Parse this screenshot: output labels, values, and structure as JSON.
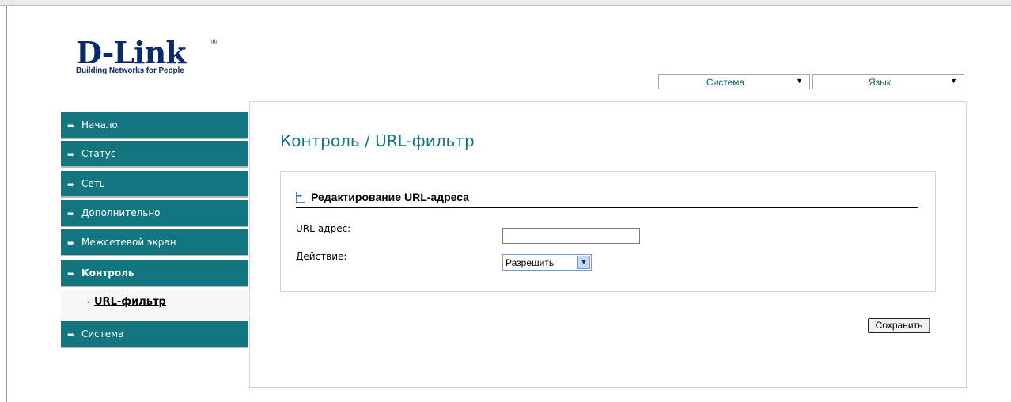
{
  "logo": {
    "name": "D-Link",
    "registered": "®",
    "tagline": "Building Networks for People"
  },
  "top_selectors": {
    "system": {
      "value": "Система",
      "icon": "triangle-down-icon"
    },
    "language": {
      "value": "Язык",
      "icon": "triangle-down-icon"
    }
  },
  "sidebar": {
    "items": [
      {
        "label": "Начало",
        "icon": "arrow-right-icon",
        "active": false
      },
      {
        "label": "Статус",
        "icon": "arrow-right-icon",
        "active": false
      },
      {
        "label": "Сеть",
        "icon": "arrow-right-icon",
        "active": false
      },
      {
        "label": "Дополнительно",
        "icon": "arrow-right-icon",
        "active": false
      },
      {
        "label": "Межсетевой экран",
        "icon": "arrow-right-icon",
        "active": false
      },
      {
        "label": "Контроль",
        "icon": "arrow-right-icon",
        "active": true
      },
      {
        "label": "Система",
        "icon": "arrow-right-icon",
        "active": false
      }
    ],
    "subitem": {
      "label": "URL-фильтр",
      "icon": "chevron-right-icon"
    }
  },
  "main": {
    "title": "Контроль / URL-фильтр",
    "section": {
      "title": "Редактирование URL-адреса",
      "icon": "page-arrow-icon",
      "fields": {
        "url": {
          "label": "URL-адрес:",
          "value": ""
        },
        "action": {
          "label": "Действие:",
          "value": "Разрешить"
        }
      }
    },
    "save_label": "Сохранить"
  },
  "colors": {
    "nav_bg": "#127580",
    "title": "#127580",
    "brand": "#0b2a6b"
  }
}
